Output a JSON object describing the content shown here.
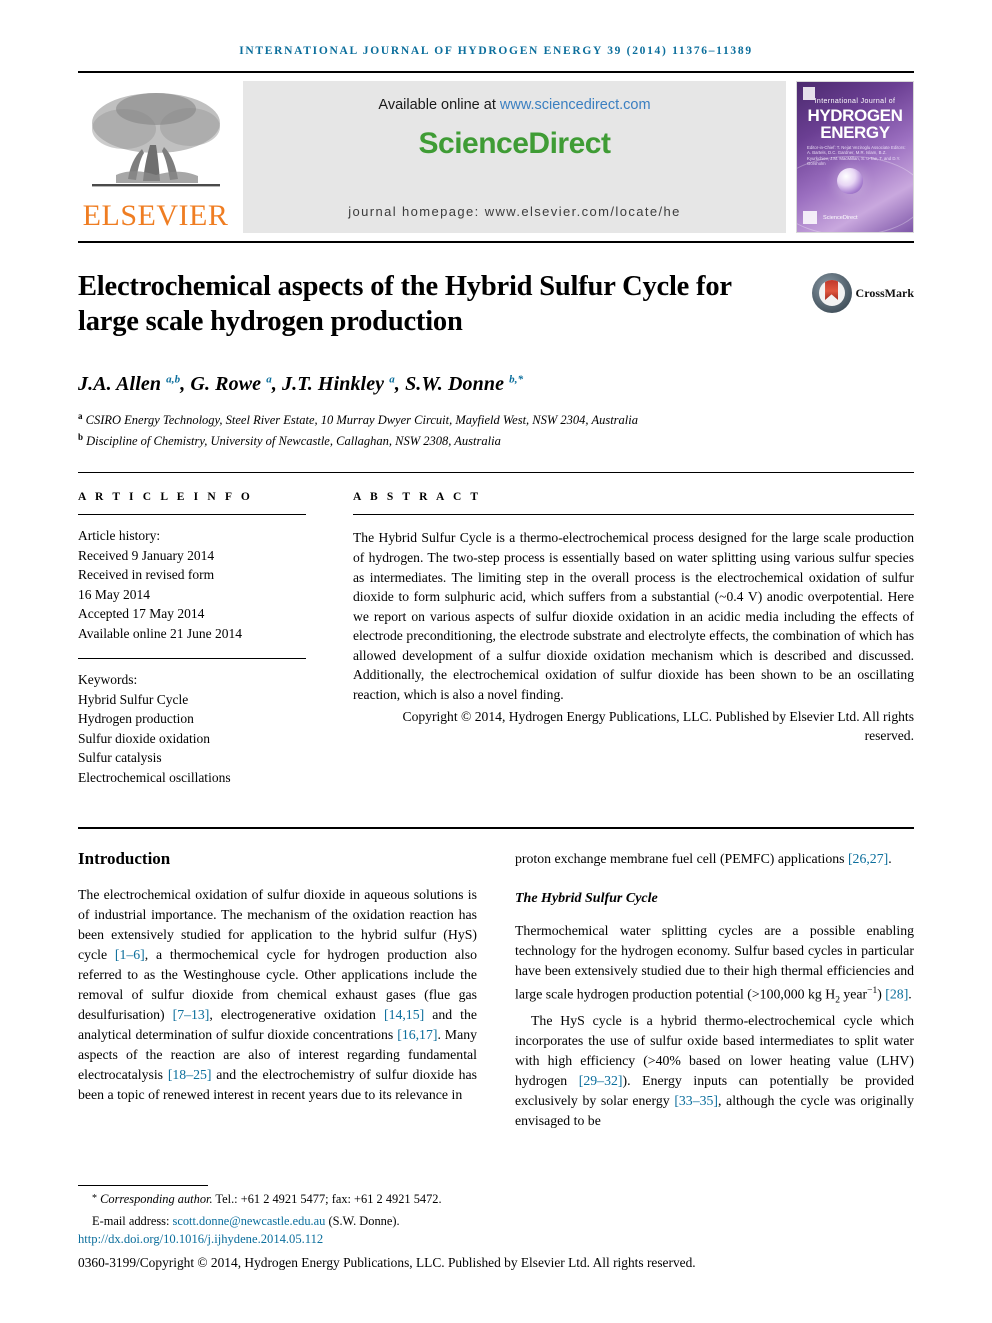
{
  "running_head": "INTERNATIONAL JOURNAL OF HYDROGEN ENERGY 39 (2014) 11376–11389",
  "masthead": {
    "publisher_name": "ELSEVIER",
    "available_prefix": "Available online at ",
    "available_url": "www.sciencedirect.com",
    "sciencedirect_logo": "ScienceDirect",
    "homepage_line": "journal homepage: www.elsevier.com/locate/he",
    "cover": {
      "small_title": "International Journal of",
      "big_title_line1": "HYDROGEN",
      "big_title_line2": "ENERGY",
      "editors": "Editor-in-Chief: T. Nejat Veziroglu   Associate Editors: A. Bartels, D.C. Gardner, M.R. Islam, B.Z. Kyurkchiev, J.M. MacMillan, S. u-Tae, T. and D.Y. Gorsholm",
      "sciencedirect_mark": "ScienceDirect"
    }
  },
  "article": {
    "title": "Electrochemical aspects of the Hybrid Sulfur Cycle for large scale hydrogen production",
    "crossmark_label": "CrossMark",
    "authors_html": "J.A. Allen <sup>a,b</sup>, G. Rowe <sup>a</sup>, J.T. Hinkley <sup>a</sup>, S.W. Donne <sup>b,</sup><sup>*</sup>",
    "affiliations": [
      "CSIRO Energy Technology, Steel River Estate, 10 Murray Dwyer Circuit, Mayfield West, NSW 2304, Australia",
      "Discipline of Chemistry, University of Newcastle, Callaghan, NSW 2308, Australia"
    ],
    "affiliation_marks": [
      "a",
      "b"
    ]
  },
  "article_info": {
    "label": "A R T I C L E  I N F O",
    "history_title": "Article history:",
    "history": [
      "Received 9 January 2014",
      "Received in revised form",
      "16 May 2014",
      "Accepted 17 May 2014",
      "Available online 21 June 2014"
    ],
    "keywords_title": "Keywords:",
    "keywords": [
      "Hybrid Sulfur Cycle",
      "Hydrogen production",
      "Sulfur dioxide oxidation",
      "Sulfur catalysis",
      "Electrochemical oscillations"
    ]
  },
  "abstract": {
    "label": "A B S T R A C T",
    "text": "The Hybrid Sulfur Cycle is a thermo-electrochemical process designed for the large scale production of hydrogen. The two-step process is essentially based on water splitting using various sulfur species as intermediates. The limiting step in the overall process is the electrochemical oxidation of sulfur dioxide to form sulphuric acid, which suffers from a substantial (~0.4 V) anodic overpotential. Here we report on various aspects of sulfur dioxide oxidation in an acidic media including the effects of electrode preconditioning, the electrode substrate and electrolyte effects, the combination of which has allowed development of a sulfur dioxide oxidation mechanism which is described and discussed. Additionally, the electrochemical oxidation of sulfur dioxide has been shown to be an oscillating reaction, which is also a novel finding.",
    "copyright": "Copyright © 2014, Hydrogen Energy Publications, LLC. Published by Elsevier Ltd. All rights reserved."
  },
  "body": {
    "section_heading": "Introduction",
    "left_paragraph_html": "The electrochemical oxidation of sulfur dioxide in aqueous solutions is of industrial importance. The mechanism of the oxidation reaction has been extensively studied for application to the hybrid sulfur (HyS) cycle <span class=\"cite\">[1–6]</span>, a thermochemical cycle for hydrogen production also referred to as the Westinghouse cycle. Other applications include the removal of sulfur dioxide from chemical exhaust gases (flue gas desulfurisation) <span class=\"cite\">[7–13]</span>, electrogenerative oxidation <span class=\"cite\">[14,15]</span> and the analytical determination of sulfur dioxide concentrations <span class=\"cite\">[16,17]</span>. Many aspects of the reaction are also of interest regarding fundamental electrocatalysis <span class=\"cite\">[18–25]</span> and the electrochemistry of sulfur dioxide has been a topic of renewed interest in recent years due to its relevance in",
    "right_continuation_html": "proton exchange membrane fuel cell (PEMFC) applications <span class=\"cite\">[26,27]</span>.",
    "subsection_heading": "The Hybrid Sulfur Cycle",
    "right_paragraph1_html": "Thermochemical water splitting cycles are a possible enabling technology for the hydrogen economy. Sulfur based cycles in particular have been extensively studied due to their high thermal efficiencies and large scale hydrogen production potential (&gt;100,000 kg H<sub>2</sub> year<sup>−1</sup>) <span class=\"cite\">[28]</span>.",
    "right_paragraph2_html": "The HyS cycle is a hybrid thermo-electrochemical cycle which incorporates the use of sulfur oxide based intermediates to split water with high efficiency (&gt;40% based on lower heating value (LHV) hydrogen <span class=\"cite\">[29–32]</span>). Energy inputs can potentially be provided exclusively by solar energy <span class=\"cite\">[33–35]</span>, although the cycle was originally envisaged to be"
  },
  "footer": {
    "corresponding_html": "<span class=\"star\">*</span> <i>Corresponding author.</i> Tel.: +61 2 4921 5477; fax: +61 2 4921 5472.",
    "email_label": "E-mail address: ",
    "email": "scott.donne@newcastle.edu.au",
    "email_suffix": " (S.W. Donne).",
    "doi": "http://dx.doi.org/10.1016/j.ijhydene.2014.05.112",
    "issn_copyright": "0360-3199/Copyright © 2014, Hydrogen Energy Publications, LLC. Published by Elsevier Ltd. All rights reserved."
  },
  "colors": {
    "link_teal": "#0b6e9c",
    "elsevier_orange": "#ef7d22",
    "sciencedirect_green": "#3f9c35",
    "banner_gray": "#e6e6e6",
    "crossmark_red": "#c0392b"
  }
}
